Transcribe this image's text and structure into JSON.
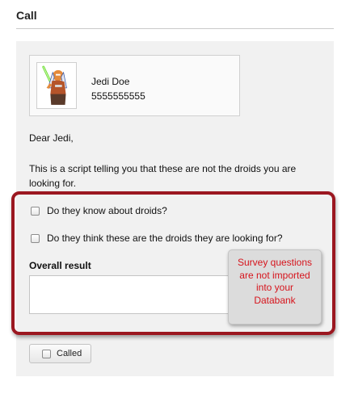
{
  "page": {
    "title": "Call"
  },
  "contact": {
    "name": "Jedi Doe",
    "phone": "5555555555",
    "avatar_icon": "jedi-avatar-image"
  },
  "script": {
    "greeting": "Dear Jedi,",
    "body": "This is a script telling you that these are not the droids you are looking for."
  },
  "survey": {
    "questions": [
      {
        "label": "Do they know about droids?",
        "checked": false
      },
      {
        "label": "Do they think these are the droids they are looking for?",
        "checked": false
      }
    ],
    "overall_result_label": "Overall result",
    "overall_result_value": ""
  },
  "callout": {
    "text": "Survey questions are not imported into your Databank"
  },
  "actions": {
    "called_label": "Called",
    "called_checked": false
  },
  "colors": {
    "highlight_border": "#9b1720",
    "callout_text": "#d6141c",
    "panel_background": "#f1f1f1"
  }
}
